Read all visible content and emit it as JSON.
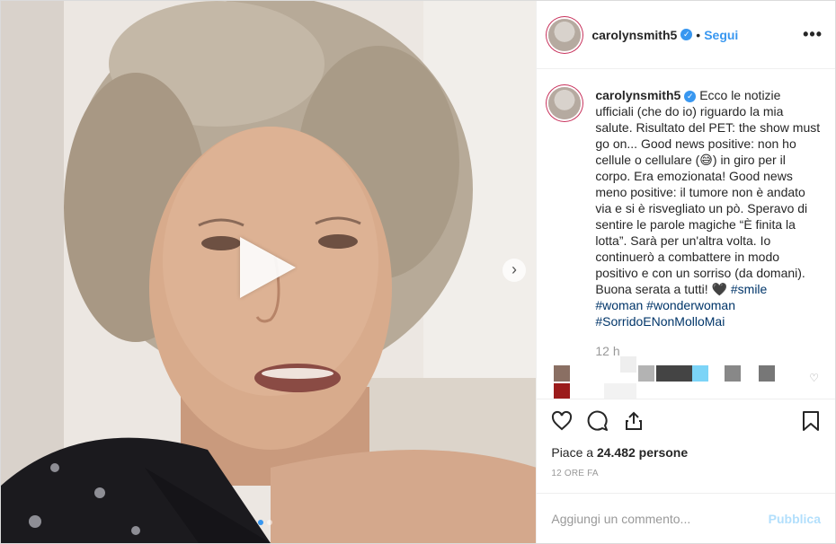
{
  "account": {
    "username": "carolynsmith5",
    "separator": "•",
    "follow_label": "Segui",
    "more_label": "•••"
  },
  "caption": {
    "username": "carolynsmith5",
    "text": "Ecco le notizie ufficiali (che do io) riguardo la mia salute. Risultato del PET: the show must go on... Good news positive: non ho cellule o cellulare (😅) in giro per il corpo. Era emozionata! Good news meno positive: il tumore non è andato via e si è risvegliato un pò. Speravo di sentire le parole magiche “È finita la lotta”. Sarà per un'altra volta. Io continuerò a combattere in modo positivo e con un sorriso (da domani). Buona serata a tutti! 🖤 ",
    "hashtags": [
      "#smile",
      "#woman",
      "#wonderwoman",
      "#SorridoENonMolloMai"
    ],
    "time_ago": "12 h"
  },
  "likes": {
    "prefix": "Piace a",
    "count": "24.482",
    "suffix": "persone"
  },
  "date": "12 ORE FA",
  "comment_input": {
    "placeholder": "Aggiungi un commento...",
    "publish_label": "Pubblica"
  },
  "media": {
    "type": "video",
    "slide_count": 2,
    "active_slide": 1
  },
  "icons": {
    "play": "play-icon",
    "next": "chevron-right-icon",
    "like": "heart-icon",
    "comment": "comment-bubble-icon",
    "share": "share-icon",
    "save": "bookmark-icon",
    "verified": "verified-badge-icon"
  },
  "colors": {
    "accent": "#3897f0",
    "hashtag": "#003569",
    "muted": "#999999",
    "publish_disabled": "#b2dffc"
  }
}
